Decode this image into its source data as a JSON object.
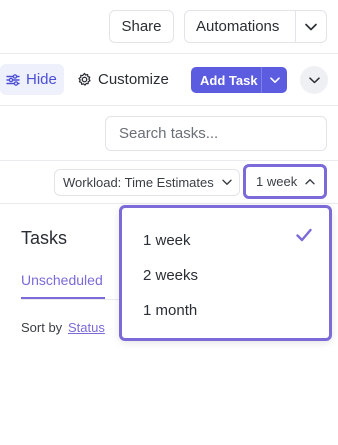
{
  "header": {
    "share_label": "Share",
    "automations_label": "Automations"
  },
  "toolbar": {
    "hide_label": "Hide",
    "customize_label": "Customize",
    "add_task_label": "Add Task",
    "search_placeholder": "Search tasks...",
    "search_value": ""
  },
  "filters": {
    "workload_label": "Workload: Time Estimates",
    "range_label": "1 week"
  },
  "tasks_panel": {
    "title": "Tasks",
    "tab_label": "Unscheduled",
    "sort_by_label": "Sort by",
    "sort_by_value": "Status"
  },
  "range_dropdown": {
    "options": [
      "1 week",
      "2 weeks",
      "1 month"
    ],
    "selected": "1 week"
  },
  "colors": {
    "accent": "#7b6ad8",
    "primary_button": "#5b5ce0",
    "hide_button_bg": "#eef0fb",
    "border": "#e3e4e8"
  },
  "icons": [
    "chevron-down-icon",
    "sliders-icon",
    "gear-icon",
    "chevron-up-icon",
    "check-icon"
  ]
}
